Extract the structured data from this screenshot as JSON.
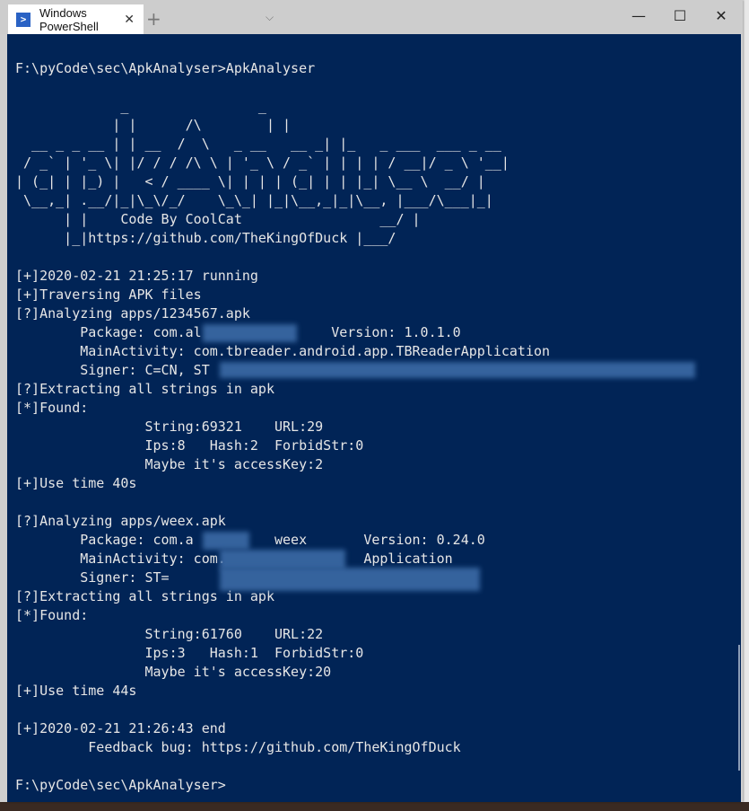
{
  "window": {
    "tab_title": "Windows PowerShell",
    "tab_close": "✕",
    "new_tab": "+",
    "dropdown": "⌵",
    "minimize": "—",
    "maximize": "☐",
    "close": "✕"
  },
  "terminal": {
    "lines": [
      "F:\\pyCode\\sec\\ApkAnalyser>ApkAnalyser",
      "",
      "             _                _",
      "            | |      /\\        | |",
      "  __ _ _ __ | | __  /  \\   _ __   __ _| |_   _ ___  ___ _ __",
      " / _` | '_ \\| |/ / / /\\ \\ | '_ \\ / _` | | | | / __|/ _ \\ '__|",
      "| (_| | |_) |   < / ____ \\| | | | (_| | | |_| \\__ \\  __/ |",
      " \\__,_| .__/|_|\\_\\/_/    \\_\\_| |_|\\__,_|_|\\__, |___/\\___|_|",
      "      | |    Code By CoolCat                 __/ |",
      "      |_|https://github.com/TheKingOfDuck |___/",
      "",
      "[+]2020-02-21 21:25:17 running",
      "[+]Traversing APK files",
      "[?]Analyzing apps/1234567.apk",
      "        Package: com.al                Version: 1.0.1.0",
      "        MainActivity: com.tbreader.android.app.TBReaderApplication",
      "        Signer: C=CN, ST",
      "[?]Extracting all strings in apk",
      "[*]Found:",
      "                String:69321    URL:29",
      "                Ips:8   Hash:2  ForbidStr:0",
      "                Maybe it's accessKey:2",
      "[+]Use time 40s",
      "",
      "[?]Analyzing apps/weex.apk",
      "        Package: com.a          weex       Version: 0.24.0",
      "        MainActivity: com.                 Application",
      "        Signer: ST=",
      "[?]Extracting all strings in apk",
      "[*]Found:",
      "                String:61760    URL:22",
      "                Ips:3   Hash:1  ForbidStr:0",
      "                Maybe it's accessKey:20",
      "[+]Use time 44s",
      "",
      "[+]2020-02-21 21:26:43 end",
      "         Feedback bug: https://github.com/TheKingOfDuck",
      "",
      "F:\\pyCode\\sec\\ApkAnalyser>"
    ]
  },
  "colors": {
    "terminal_bg": "#012456",
    "terminal_fg": "#e6e6e6"
  }
}
